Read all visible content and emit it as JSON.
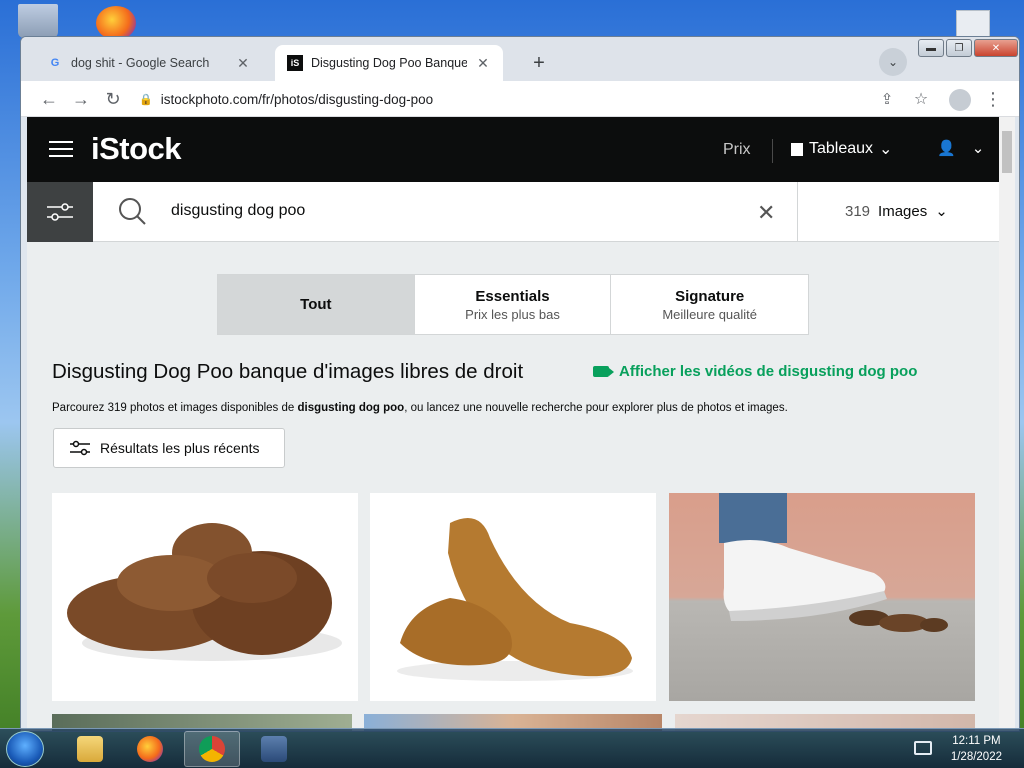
{
  "browser": {
    "tabs": [
      {
        "title": "dog shit - Google Search",
        "favicon": "G",
        "active": false
      },
      {
        "title": "Disgusting Dog Poo Banque d'im",
        "favicon": "iS",
        "active": true
      }
    ],
    "new_tab_label": "+",
    "url": "istockphoto.com/fr/photos/disgusting-dog-poo"
  },
  "site": {
    "logo": "iStock",
    "nav": {
      "prix": "Prix",
      "boards": "Tableaux"
    }
  },
  "search": {
    "query": "disgusting dog poo",
    "result_count": "319",
    "media_type": "Images"
  },
  "tiers": [
    {
      "name": "Tout",
      "sub": ""
    },
    {
      "name": "Essentials",
      "sub": "Prix les plus bas"
    },
    {
      "name": "Signature",
      "sub": "Meilleure qualité"
    }
  ],
  "results": {
    "title": "Disgusting Dog Poo banque d'images libres de droit",
    "video_link": "Afficher les vidéos de disgusting dog poo",
    "desc_prefix": "Parcourez 319 photos et images disponibles de ",
    "desc_bold": "disgusting dog poo",
    "desc_suffix": ", ou lancez une nouvelle recherche pour explorer plus de photos et images.",
    "sort_label": "Résultats les plus récents"
  },
  "taskbar": {
    "time": "12:11 PM",
    "date": "1/28/2022"
  },
  "colors": {
    "accent_green": "#08a05c",
    "header_black": "#0c0d0d"
  }
}
